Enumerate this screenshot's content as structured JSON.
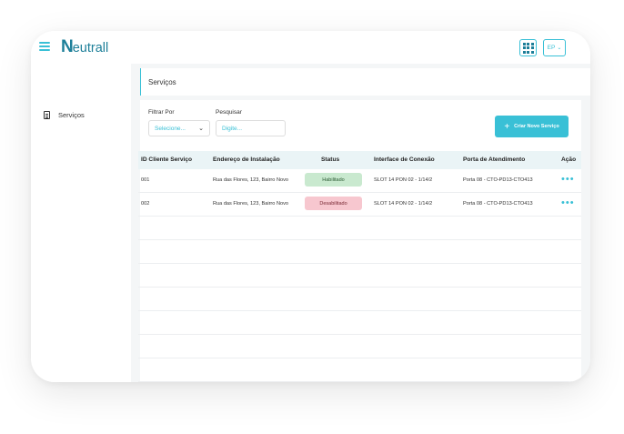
{
  "app": {
    "brand": "eutrall",
    "brand_mark": "N",
    "accent": "#39c0d6"
  },
  "header": {
    "language": "EP"
  },
  "sidebar": {
    "items": [
      {
        "label": "Serviços",
        "icon": "document-icon"
      }
    ]
  },
  "page": {
    "title": "Serviços"
  },
  "filters": {
    "filter_label": "Filtrar Por",
    "filter_placeholder": "Selecione...",
    "search_label": "Pesquisar",
    "search_placeholder": "Digite..."
  },
  "actions": {
    "create_label": "Criar Novo Serviço"
  },
  "table": {
    "columns": [
      "ID Cliente Serviço",
      "Endereço de Instalação",
      "Status",
      "Interface de Conexão",
      "Porta de Atendimento",
      "Ação"
    ],
    "rows": [
      {
        "id": "001",
        "address": "Rua das Flores, 123, Bairro Novo",
        "status": "Habilitado",
        "status_color": "#c9e9cf",
        "interface": "SLOT 14 PON 02 - 1/14/2",
        "port": "Porta 08 - CTO-PD13-CTO413"
      },
      {
        "id": "002",
        "address": "Rua das Flores, 123, Bairro Novo",
        "status": "Desabilitado",
        "status_color": "#f7c7cf",
        "interface": "SLOT 14 PON 02 - 1/14/2",
        "port": "Porta 08 - CTO-PD13-CTO413"
      }
    ]
  }
}
